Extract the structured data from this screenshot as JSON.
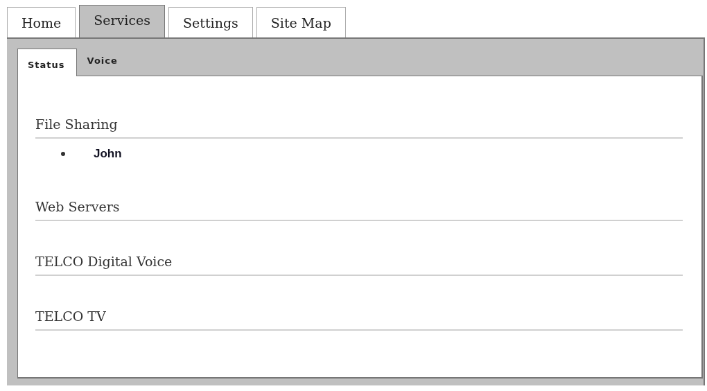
{
  "tabs": [
    {
      "label": "Home",
      "selected": false
    },
    {
      "label": "Services",
      "selected": true
    },
    {
      "label": "Settings",
      "selected": false
    },
    {
      "label": "Site Map",
      "selected": false
    }
  ],
  "subtabs": [
    {
      "label": "Status",
      "selected": true
    },
    {
      "label": "Voice",
      "selected": false
    }
  ],
  "sections": [
    {
      "title": "File Sharing",
      "items": [
        "John"
      ]
    },
    {
      "title": "Web Servers"
    },
    {
      "title": "TELCO Digital Voice"
    },
    {
      "title": "TELCO TV"
    }
  ]
}
